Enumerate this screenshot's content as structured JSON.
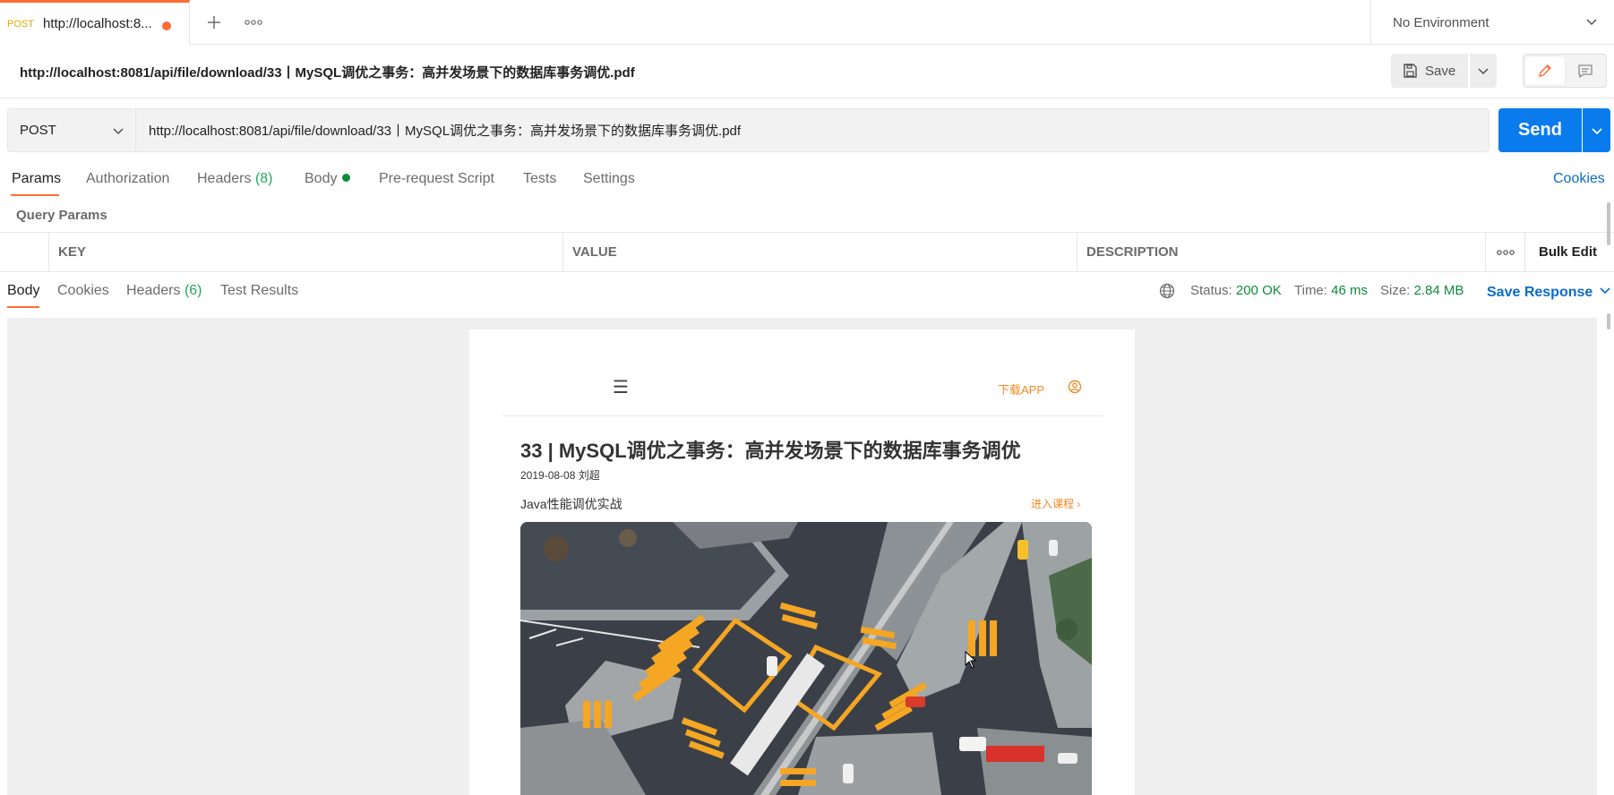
{
  "tab": {
    "method": "POST",
    "title": "http://localhost:8...",
    "add_icon": "plus-icon",
    "more_icon": "more-horizontal-icon"
  },
  "environment": {
    "label": "No Environment"
  },
  "request": {
    "title": "http://localhost:8081/api/file/download/33丨MySQL调优之事务：高并发场景下的数据库事务调优.pdf",
    "save_label": "Save",
    "method": "POST",
    "url": "http://localhost:8081/api/file/download/33丨MySQL调优之事务：高并发场景下的数据库事务调优.pdf",
    "send_label": "Send"
  },
  "req_tabs": {
    "params": "Params",
    "authorization": "Authorization",
    "headers": "Headers",
    "headers_count": "(8)",
    "body": "Body",
    "prerequest": "Pre-request Script",
    "tests": "Tests",
    "settings": "Settings",
    "cookies": "Cookies"
  },
  "query_params": {
    "label": "Query Params",
    "columns": [
      "KEY",
      "VALUE",
      "DESCRIPTION"
    ],
    "bulk_edit": "Bulk Edit"
  },
  "response": {
    "tabs": {
      "body": "Body",
      "cookies": "Cookies",
      "headers": "Headers",
      "headers_count": "(6)",
      "test_results": "Test Results"
    },
    "status_label": "Status:",
    "status_value": "200 OK",
    "time_label": "Time:",
    "time_value": "46 ms",
    "size_label": "Size:",
    "size_value": "2.84 MB",
    "save_response": "Save Response"
  },
  "preview": {
    "menu_icon": "☰",
    "download_app": "下载APP",
    "title": "33 | MySQL调优之事务：高并发场景下的数据库事务调优",
    "meta": "2019-08-08 刘超",
    "course": "Java性能调优实战",
    "enter_course": "进入课程 ›"
  },
  "colors": {
    "accent": "#ff6c37",
    "send": "#097bed",
    "link": "#0b6bcb",
    "success": "#0f8a3d",
    "preview_accent": "#f08a24"
  }
}
